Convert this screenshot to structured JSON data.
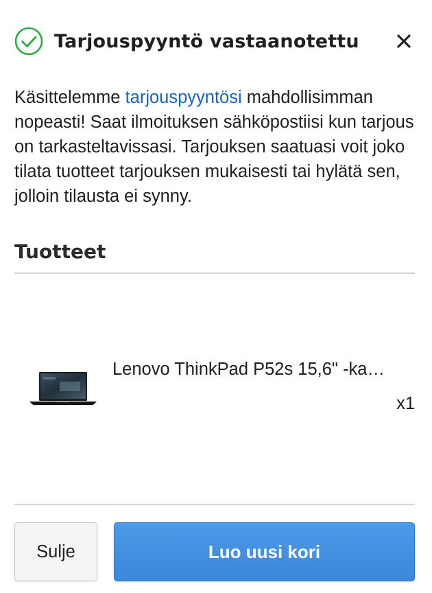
{
  "dialog": {
    "title": "Tarjouspyyntö vastaanotettu",
    "status_icon": "check-circle-icon",
    "close_icon": "close-icon",
    "accent_color": "#2cab3d",
    "link_color": "#1565c0"
  },
  "message": {
    "before_link": "Käsittelemme ",
    "link_text": "tarjouspyyntösi",
    "after_link": " mahdollisimman nopeasti! Saat ilmoituksen sähköpostiisi kun tarjous on tarkasteltavissasi. Tarjouksen saatuasi voit joko tilata tuotteet tarjouksen mukaisesti tai hylätä sen, jolloin tilausta ei synny."
  },
  "products": {
    "heading": "Tuotteet",
    "items": [
      {
        "name": "Lenovo ThinkPad P52s 15,6\" -ka…",
        "quantity": "x1",
        "image": "laptop-image"
      }
    ]
  },
  "actions": {
    "close_label": "Sulje",
    "new_cart_label": "Luo uusi kori",
    "primary_color": "#4290e2"
  }
}
